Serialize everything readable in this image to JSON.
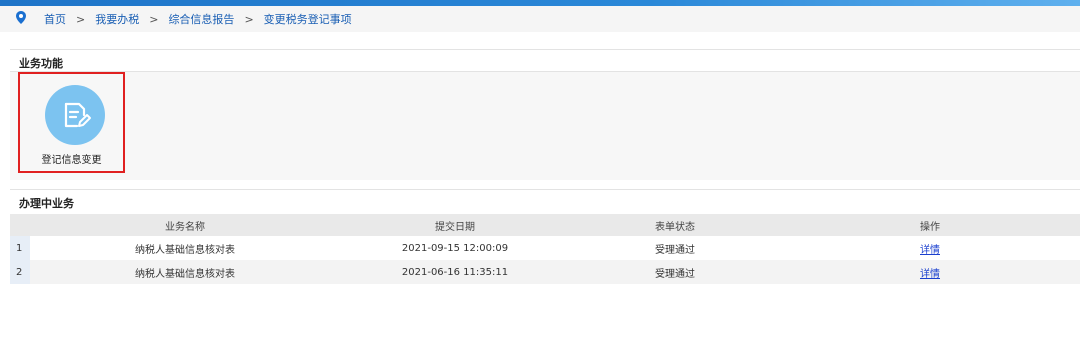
{
  "breadcrumb": {
    "items": [
      "首页",
      "我要办税",
      "综合信息报告",
      "变更税务登记事项"
    ],
    "separator": ">"
  },
  "business_functions": {
    "title": "业务功能",
    "tiles": [
      {
        "label": "登记信息变更",
        "icon": "edit-document-icon"
      }
    ]
  },
  "in_progress": {
    "title": "办理中业务",
    "columns": [
      "业务名称",
      "提交日期",
      "表单状态",
      "操作"
    ],
    "rows": [
      {
        "index": "1",
        "name": "纳税人基础信息核对表",
        "date": "2021-09-15 12:00:09",
        "status": "受理通过",
        "action": "详情"
      },
      {
        "index": "2",
        "name": "纳税人基础信息核对表",
        "date": "2021-06-16 11:35:11",
        "status": "受理通过",
        "action": "详情"
      }
    ]
  },
  "colors": {
    "accent": "#1a5fb4",
    "highlight_border": "#e02020",
    "icon_circle": "#7cc3f0"
  }
}
